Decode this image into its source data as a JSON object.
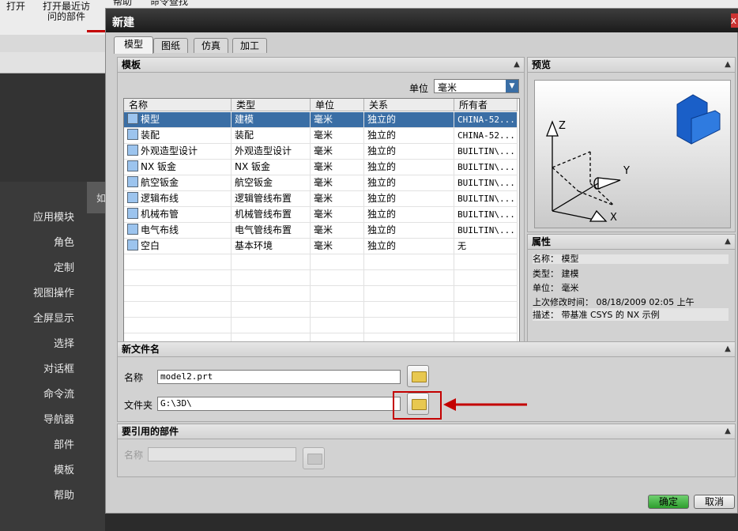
{
  "toolbar": {
    "open": "打开",
    "recent_line1": "打开最近访",
    "recent_line2": "问的部件",
    "help": "帮助",
    "command_find": "命令查找"
  },
  "sidebar": {
    "tab_label": "如",
    "items": [
      "应用模块",
      "角色",
      "定制",
      "视图操作",
      "全屏显示",
      "选择",
      "对话框",
      "命令流",
      "导航器",
      "部件",
      "模板",
      "帮助"
    ]
  },
  "dialog": {
    "title": "新建",
    "close_glyph": "x",
    "tabs": [
      "模型",
      "图纸",
      "仿真",
      "加工"
    ],
    "templates": {
      "header": "模板",
      "unit_label": "单位",
      "unit_value": "毫米",
      "columns": [
        "名称",
        "类型",
        "单位",
        "关系",
        "所有者"
      ],
      "rows": [
        {
          "name": "模型",
          "type": "建模",
          "unit": "毫米",
          "relation": "独立的",
          "owner": "CHINA-52..."
        },
        {
          "name": "装配",
          "type": "装配",
          "unit": "毫米",
          "relation": "独立的",
          "owner": "CHINA-52..."
        },
        {
          "name": "外观造型设计",
          "type": "外观造型设计",
          "unit": "毫米",
          "relation": "独立的",
          "owner": "BUILTIN\\..."
        },
        {
          "name": "NX 钣金",
          "type": "NX 钣金",
          "unit": "毫米",
          "relation": "独立的",
          "owner": "BUILTIN\\..."
        },
        {
          "name": "航空钣金",
          "type": "航空钣金",
          "unit": "毫米",
          "relation": "独立的",
          "owner": "BUILTIN\\..."
        },
        {
          "name": "逻辑布线",
          "type": "逻辑管线布置",
          "unit": "毫米",
          "relation": "独立的",
          "owner": "BUILTIN\\..."
        },
        {
          "name": "机械布管",
          "type": "机械管线布置",
          "unit": "毫米",
          "relation": "独立的",
          "owner": "BUILTIN\\..."
        },
        {
          "name": "电气布线",
          "type": "电气管线布置",
          "unit": "毫米",
          "relation": "独立的",
          "owner": "BUILTIN\\..."
        },
        {
          "name": "空白",
          "type": "基本环境",
          "unit": "毫米",
          "relation": "独立的",
          "owner": "无"
        }
      ]
    },
    "preview": {
      "header": "预览",
      "axis_z": "Z",
      "axis_y": "Y",
      "axis_x": "X"
    },
    "properties": {
      "header": "属性",
      "name": "名称： 模型",
      "type": "类型： 建模",
      "unit": "单位： 毫米",
      "modified": "上次修改时间： 08/18/2009 02:05 上午",
      "description": "描述： 带基准 CSYS 的 NX 示例"
    },
    "new_file": {
      "header": "新文件名",
      "name_label": "名称",
      "name_value": "model2.prt",
      "folder_label": "文件夹",
      "folder_value": "G:\\3D\\"
    },
    "ref_part": {
      "header": "要引用的部件",
      "name_label": "名称"
    },
    "buttons": {
      "ok": "确定",
      "cancel": "取消"
    }
  },
  "colors": {
    "selection": "#3a6ea5",
    "annotation_red": "#c40000",
    "ok_button": "#3bb33b"
  }
}
